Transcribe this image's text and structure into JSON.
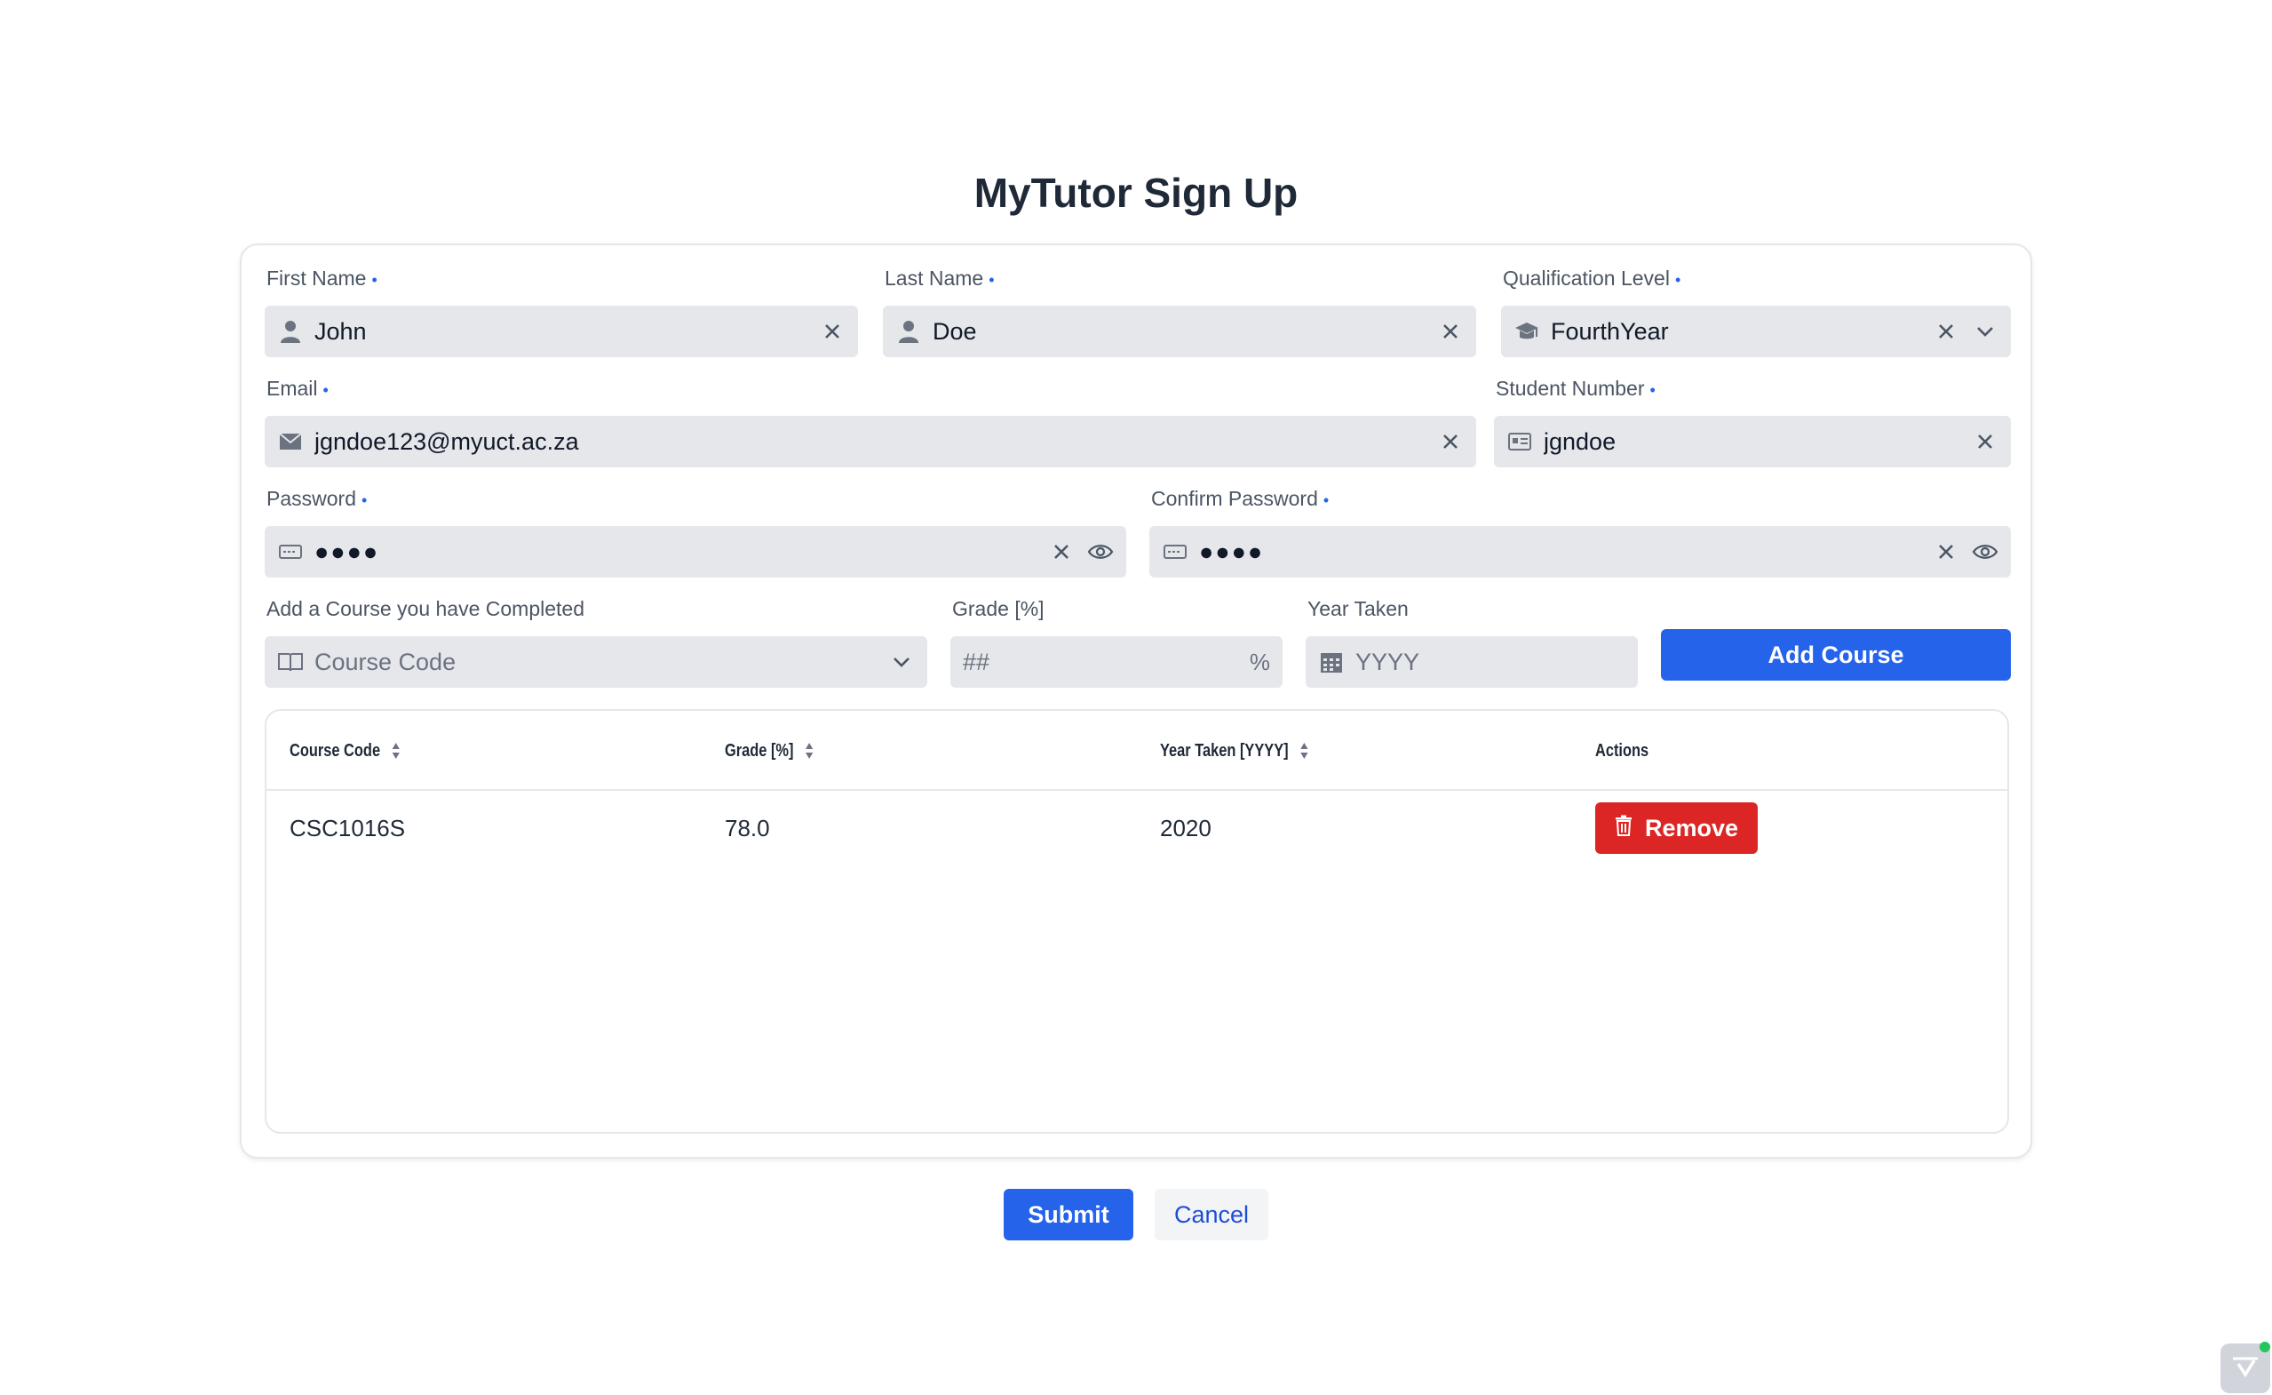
{
  "page": {
    "title": "MyTutor Sign Up"
  },
  "form": {
    "first_name": {
      "label": "First Name",
      "required_mark": "•",
      "value": "John",
      "icon": "user-icon"
    },
    "last_name": {
      "label": "Last Name",
      "required_mark": "•",
      "value": "Doe",
      "icon": "user-icon"
    },
    "qualification": {
      "label": "Qualification Level",
      "required_mark": "•",
      "value": "FourthYear",
      "icon": "graduation-cap-icon"
    },
    "email": {
      "label": "Email",
      "required_mark": "•",
      "value": "jgndoe123@myuct.ac.za",
      "icon": "envelope-icon"
    },
    "student_number": {
      "label": "Student Number",
      "required_mark": "•",
      "value": "jgndoe",
      "icon": "id-card-icon"
    },
    "password": {
      "label": "Password",
      "required_mark": "•",
      "value": "●●●●",
      "icon": "keyboard-icon"
    },
    "confirm_password": {
      "label": "Confirm Password",
      "required_mark": "•",
      "value": "●●●●",
      "icon": "keyboard-icon"
    }
  },
  "course_entry": {
    "course": {
      "label": "Add a Course you have Completed",
      "placeholder": "Course Code",
      "icon": "book-icon"
    },
    "grade": {
      "label": "Grade [%]",
      "placeholder": "##",
      "suffix": "%"
    },
    "year": {
      "label": "Year Taken",
      "placeholder": "YYYY",
      "icon": "calendar-icon"
    },
    "add_button": "Add Course"
  },
  "table": {
    "columns": [
      "Course Code",
      "Grade [%]",
      "Year Taken [YYYY]",
      "Actions"
    ],
    "rows": [
      {
        "course_code": "CSC1016S",
        "grade": "78.0",
        "year": "2020",
        "action": "Remove"
      }
    ]
  },
  "actions": {
    "submit": "Submit",
    "cancel": "Cancel"
  },
  "colors": {
    "primary": "#2563eb",
    "danger": "#dc2626",
    "input_bg": "#e5e7eb",
    "status_dot": "#22c55e"
  }
}
